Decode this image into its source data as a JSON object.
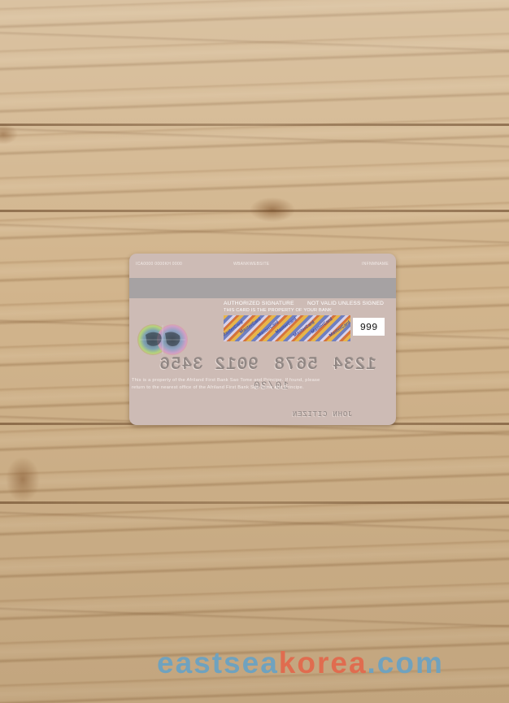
{
  "card": {
    "top_left": "ICA0000 0000KH 0000",
    "top_center": "WBANKWEBSITE",
    "top_right": "INFNMNAME",
    "authorized_signature": "AUTHORIZED SIGNATURE",
    "not_valid": "NOT VALID UNLESS SIGNED",
    "property_line": "THIS CARD IS THE PROPERTY OF YOUR BANK",
    "signature_pattern": "MasterCard",
    "cvv": "999",
    "number_groups": [
      "1234",
      "5678",
      "9012",
      "3456"
    ],
    "disclaimer_line1": "This is a property of the Afriland First Bank Sao Tome and Principe. If found, please",
    "disclaimer_line2": "return to the nearest office of the Afriland First Bank Sao Tome and Principe.",
    "expiry": "10/30",
    "cardholder": "JOHN CITIZEN",
    "colors": {
      "card": "#cdbbb5",
      "stripe": "#a6a2a3",
      "wood": "#d2b58d"
    }
  },
  "watermark": {
    "part1": "eastsea",
    "part2": "korea",
    "part3": ".com"
  }
}
